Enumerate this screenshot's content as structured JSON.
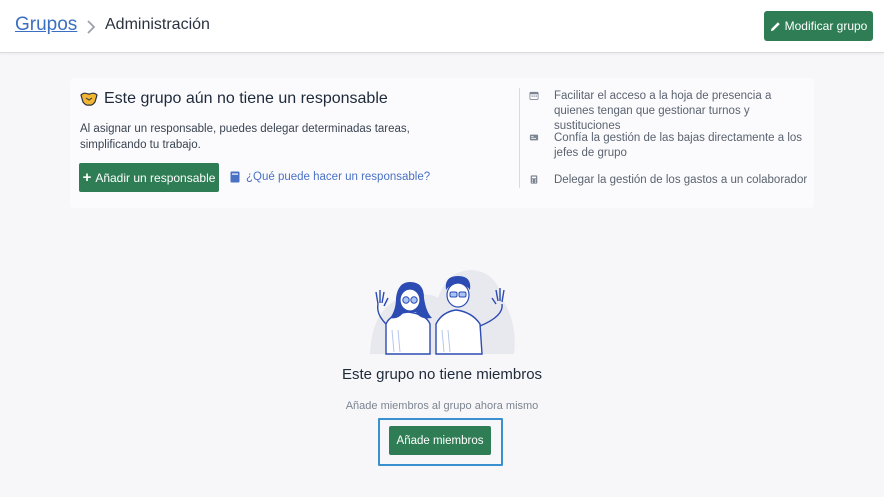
{
  "header": {
    "breadcrumb_parent": "Grupos",
    "breadcrumb_current": "Administración",
    "edit_button_label": "Modificar grupo"
  },
  "responsible_card": {
    "title": "Este grupo aún no tiene un responsable",
    "description": "Al asignar un responsable, puedes delegar determinadas tareas, simplificando tu trabajo.",
    "add_button_label": "Añadir un responsable",
    "help_link_label": "¿Qué puede hacer un responsable?",
    "features": [
      {
        "icon": "calendar-icon",
        "text": "Facilitar el acceso a la hoja de presencia a quienes tengan que gestionar turnos y sustituciones"
      },
      {
        "icon": "id-card-icon",
        "text": "Confía la gestión de las bajas directamente a los jefes de grupo"
      },
      {
        "icon": "calculator-icon",
        "text": "Delegar la gestión de los gastos a un colaborador"
      }
    ]
  },
  "empty_state": {
    "title": "Este grupo no tiene miembros",
    "subtitle": "Añade miembros al grupo ahora mismo",
    "button_label": "Añade miembros"
  },
  "colors": {
    "primary_green": "#2f7d55",
    "link_blue": "#3b6fc2",
    "focus_blue": "#3a8fce"
  }
}
